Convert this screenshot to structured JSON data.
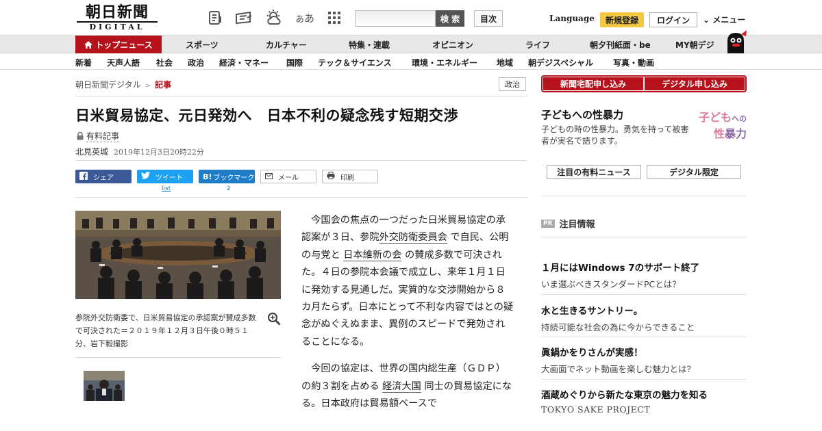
{
  "header": {
    "logo_jp": "朝日新聞",
    "logo_sub": "DIGITAL",
    "aa_label": "ぁあ",
    "search_placeholder": "",
    "search_button": "検 索",
    "toc_button": "目次",
    "language_label": "Language",
    "signup_button": "新規登録",
    "login_button": "ログイン",
    "menu_button": "メニュー"
  },
  "nav_primary": [
    "トップニュース",
    "スポーツ",
    "カルチャー",
    "特集・連載",
    "オピニオン",
    "ライフ",
    "朝夕刊紙面・be",
    "MY朝デジ"
  ],
  "nav_secondary": [
    "新着",
    "天声人語",
    "社会",
    "政治",
    "経済・マネー",
    "国際",
    "テック＆サイエンス",
    "環境・エネルギー",
    "地域",
    "朝デジスペシャル",
    "写真・動画"
  ],
  "breadcrumb": {
    "home": "朝日新聞デジタル",
    "separator": ">",
    "current": "記事"
  },
  "article": {
    "category_tag": "政治",
    "headline": "日米貿易協定、元日発効へ　日本不利の疑念残す短期交渉",
    "paid_label": "有料記事",
    "author": "北見英城",
    "date": "2019年12月3日20時22分",
    "share": {
      "facebook": "シェア",
      "twitter": "ツイート",
      "twitter_count": "list",
      "hatena": "ブックマーク",
      "hatena_count": "2",
      "mail": "メール",
      "print": "印刷"
    },
    "photo_caption": "参院外交防衛委で、日米貿易協定の承認案が賛成多数で可決された＝２０１９年１２月３日午後０時５１分、岩下毅撮影",
    "p1_a": "今国会の焦点の一つだった日米貿易協定の承認案が３日、参院",
    "p1_kw1": "外交防衛委員会",
    "p1_b": "で自民、公明の与党と",
    "p1_kw2": "日本維新の会",
    "p1_c": "の賛成多数で可決された。４日の参院本会議で成立し、来年１月１日に発効する見通しだ。実質的な交渉開始から８カ月たらず。日本にとって不利な内容ではとの疑念がぬぐえぬまま、異例のスピードで発効されることになる。",
    "p2_a": "今回の協定は、世界の国内総生産（ＧＤＰ）の約３割を占める",
    "p2_kw1": "経済大国",
    "p2_b": "同士の貿易協定になる。日本政府は貿易額ベースで"
  },
  "sidebar": {
    "subscribe_paper": "新聞宅配申し込み",
    "subscribe_digital": "デジタル申し込み",
    "promo_title": "子どもへの性暴力",
    "promo_desc": "子どもの時の性暴力。勇気を持って被害者が実名で語ります。",
    "promo_logo_l1": "子ども",
    "promo_logo_l1b": "への",
    "promo_logo_l2a": "性",
    "promo_logo_l2b": "暴力",
    "tab_paid_news": "注目の有料ニュース",
    "tab_digital_only": "デジタル限定",
    "pr_badge": "PR",
    "pr_heading": "注目情報",
    "pr_items": [
      {
        "title": "１月にはWindows 7のサポート終了",
        "desc": "いま選ぶべきスタンダードPCとは？"
      },
      {
        "title": "水と生きるサントリー。",
        "desc": "持続可能な社会の為に今からできること"
      },
      {
        "title": "眞鍋かをりさんが実感！",
        "desc": "大画面でネット動画を楽しむ魅力とは？"
      },
      {
        "title": "酒蔵めぐりから新たな東京の魅力を知る",
        "desc": "TOKYO SAKE PROJECT"
      }
    ]
  },
  "colors": {
    "brand_red": "#b5121b",
    "signup_yellow": "#f5c842",
    "facebook": "#3b5998",
    "twitter": "#1da1f2",
    "hatena": "#1f7dc8"
  },
  "icons": [
    "notebook-icon",
    "newspaper-icon",
    "weather-icon",
    "font-size-icon",
    "grid-menu-icon",
    "home-icon",
    "lock-icon",
    "zoom-icon",
    "mail-icon",
    "print-icon",
    "mascot-icon"
  ]
}
